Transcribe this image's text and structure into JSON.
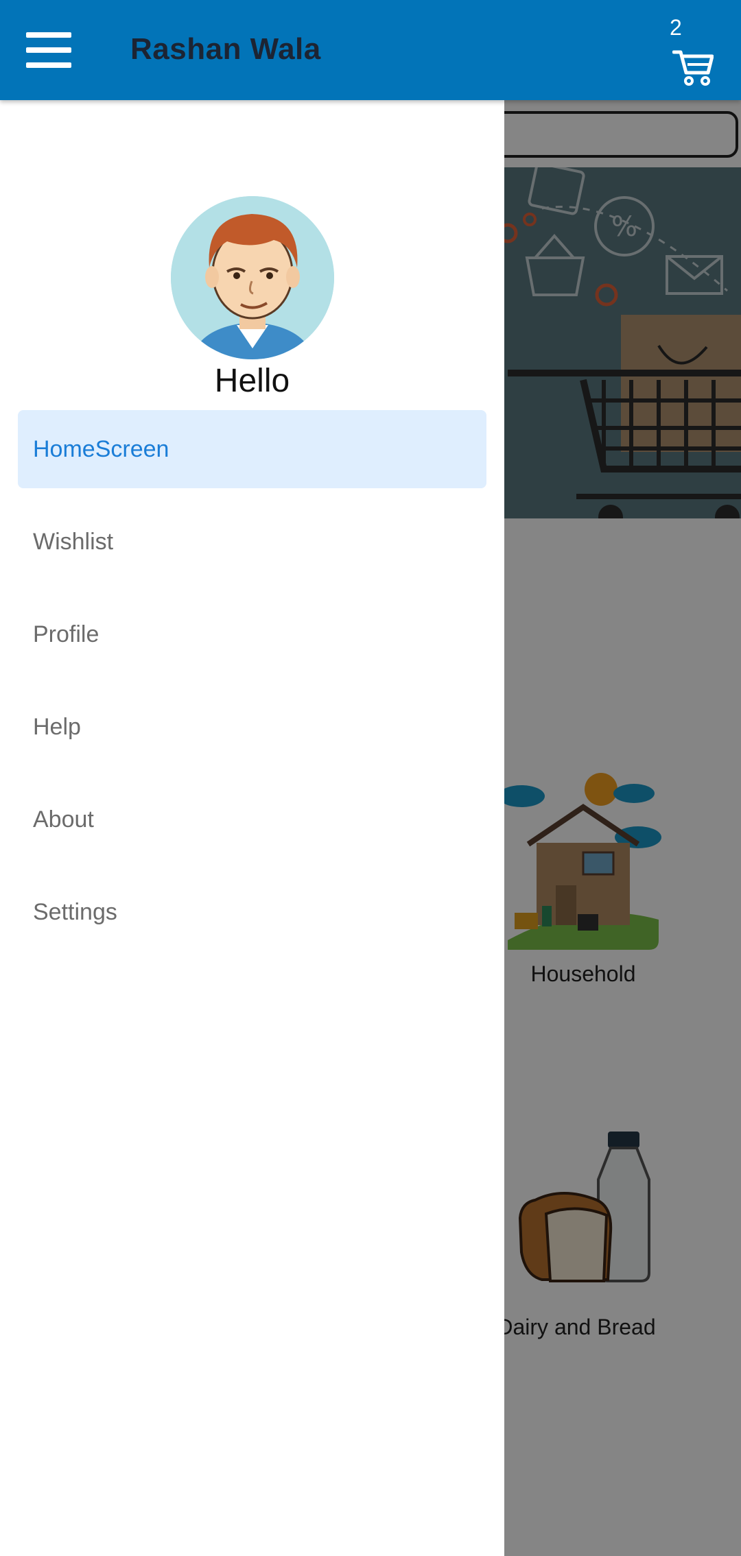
{
  "header": {
    "title": "Rashan Wala",
    "cart_count": "2",
    "background_color": "#0274b8",
    "menu_icon": "hamburger-icon",
    "cart_icon": "cart-icon"
  },
  "drawer": {
    "greeting": "Hello",
    "avatar_icon": "user-avatar",
    "active_color": "#1a7dd7",
    "items": [
      {
        "label": "HomeScreen",
        "active": true
      },
      {
        "label": "Wishlist",
        "active": false
      },
      {
        "label": "Profile",
        "active": false
      },
      {
        "label": "Help",
        "active": false
      },
      {
        "label": "About",
        "active": false
      },
      {
        "label": "Settings",
        "active": false
      }
    ]
  },
  "main": {
    "categories": [
      {
        "label": "Household"
      },
      {
        "label": "Dairy and Bread"
      }
    ]
  }
}
